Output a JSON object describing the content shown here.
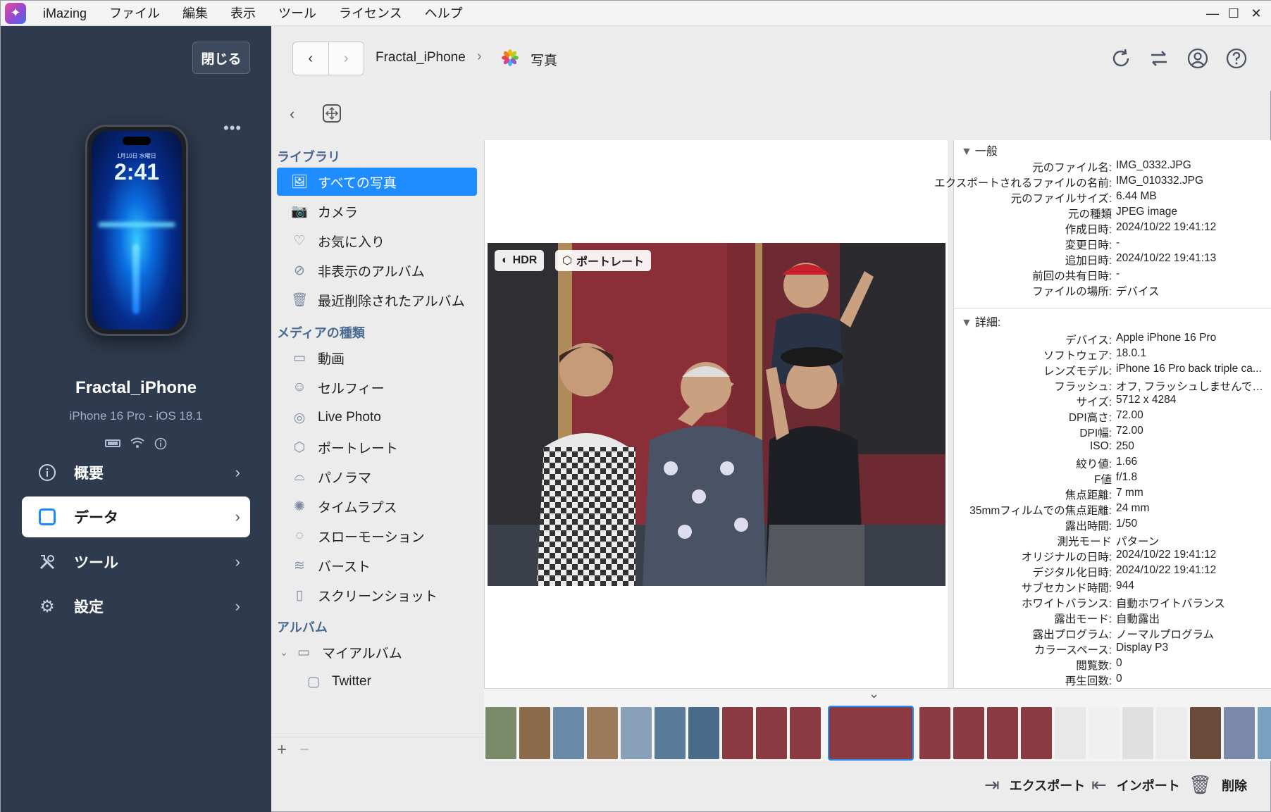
{
  "app": {
    "name": "iMazing",
    "menu": [
      "ファイル",
      "編集",
      "表示",
      "ツール",
      "ライセンス",
      "ヘルプ"
    ],
    "window_controls": [
      "minimize-icon",
      "maximize-icon",
      "close-icon"
    ]
  },
  "sidebar": {
    "close_label": "閉じる",
    "more_label": "•••",
    "phone": {
      "date": "1月10日 水曜日",
      "time": "2:41"
    },
    "device_name": "Fractal_iPhone",
    "device_model": "iPhone 16 Pro - iOS 18.1",
    "status_icons": [
      "battery-icon",
      "wifi-icon",
      "info-icon"
    ],
    "nav": [
      {
        "label": "概要",
        "icon": "info-circle-icon",
        "active": false
      },
      {
        "label": "データ",
        "icon": "data-square-icon",
        "active": true
      },
      {
        "label": "ツール",
        "icon": "tools-icon",
        "active": false
      },
      {
        "label": "設定",
        "icon": "gear-icon",
        "active": false
      }
    ],
    "accent_color": "#1a8cff"
  },
  "toolbar": {
    "breadcrumb": [
      "Fractal_iPhone",
      "写真"
    ],
    "icons": [
      "refresh-icon",
      "transfer-icon",
      "account-icon",
      "help-icon"
    ]
  },
  "library": {
    "sections": {
      "library": "ライブラリ",
      "media": "メディアの種類",
      "albums": "アルバム"
    },
    "library_items": [
      "すべての写真",
      "カメラ",
      "お気に入り",
      "非表示のアルバム",
      "最近削除されたアルバム"
    ],
    "media_items": [
      "動画",
      "セルフィー",
      "Live Photo",
      "ポートレート",
      "パノラマ",
      "タイムラプス",
      "スローモーション",
      "バースト",
      "スクリーンショット"
    ],
    "album_items": [
      "マイアルバム",
      "Twitter"
    ],
    "active_color": "#1f8dff"
  },
  "viewer": {
    "badges": [
      "HDR",
      "ポートレート"
    ]
  },
  "info": {
    "general_title": "一般",
    "general": [
      {
        "k": "元のファイル名:",
        "v": "IMG_0332.JPG"
      },
      {
        "k": "エクスポートされるファイルの名前:",
        "v": "IMG_010332.JPG"
      },
      {
        "k": "元のファイルサイズ:",
        "v": "6.44 MB"
      },
      {
        "k": "元の種類",
        "v": "JPEG image"
      },
      {
        "k": "作成日時:",
        "v": "2024/10/22 19:41:12"
      },
      {
        "k": "変更日時:",
        "v": "-"
      },
      {
        "k": "追加日時:",
        "v": "2024/10/22 19:41:13"
      },
      {
        "k": "前回の共有日時:",
        "v": "-"
      },
      {
        "k": "ファイルの場所:",
        "v": "デバイス"
      }
    ],
    "detail_title": "詳細:",
    "details": [
      {
        "k": "デバイス:",
        "v": "Apple iPhone 16 Pro"
      },
      {
        "k": "ソフトウェア:",
        "v": "18.0.1"
      },
      {
        "k": "レンズモデル:",
        "v": "iPhone 16 Pro back triple ca..."
      },
      {
        "k": "フラッシュ:",
        "v": "オフ, フラッシュしませんでした"
      },
      {
        "k": "サイズ:",
        "v": "5712 x 4284"
      },
      {
        "k": "DPI高さ:",
        "v": "72.00"
      },
      {
        "k": "DPI幅:",
        "v": "72.00"
      },
      {
        "k": "ISO:",
        "v": "250"
      },
      {
        "k": "絞り値:",
        "v": "1.66"
      },
      {
        "k": "F値",
        "v": "f/1.8"
      },
      {
        "k": "焦点距離:",
        "v": "7 mm"
      },
      {
        "k": "35mmフィルムでの焦点距離:",
        "v": "24 mm"
      },
      {
        "k": "露出時間:",
        "v": "1/50"
      },
      {
        "k": "測光モード",
        "v": "パターン"
      },
      {
        "k": "オリジナルの日時:",
        "v": "2024/10/22 19:41:12"
      },
      {
        "k": "デジタル化日時:",
        "v": "2024/10/22 19:41:12"
      },
      {
        "k": "サブセカンド時間:",
        "v": "944"
      },
      {
        "k": "ホワイトバランス:",
        "v": "自動ホワイトバランス"
      },
      {
        "k": "露出モード:",
        "v": "自動露出"
      },
      {
        "k": "露出プログラム:",
        "v": "ノーマルプログラム"
      },
      {
        "k": "カラースペース:",
        "v": "Display P3"
      },
      {
        "k": "閲覧数:",
        "v": "0"
      },
      {
        "k": "再生回数:",
        "v": "0"
      }
    ]
  },
  "actions": {
    "export": "エクスポート",
    "import": "インポート",
    "delete": "削除"
  }
}
